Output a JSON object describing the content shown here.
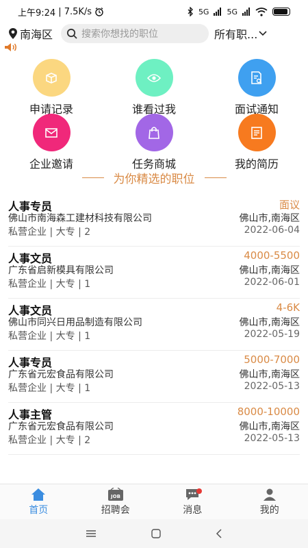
{
  "status_bar": {
    "time": "上午9:24",
    "speed": "| 7.5K/s",
    "signal1": "5G",
    "signal2": "5G"
  },
  "top_bar": {
    "location": "南海区",
    "search_placeholder": "搜索你想找的职位",
    "job_filter": "所有职..."
  },
  "quick_actions": [
    {
      "label": "申请记录",
      "icon": "box-icon",
      "color": "#fbd780"
    },
    {
      "label": "谁看过我",
      "icon": "eye-icon",
      "color": "#6ef0c2"
    },
    {
      "label": "面试通知",
      "icon": "document-search-icon",
      "color": "#3fa0f0"
    },
    {
      "label": "企业邀请",
      "icon": "envelope-icon",
      "color": "#f0287a"
    },
    {
      "label": "任务商城",
      "icon": "shopping-bag-icon",
      "color": "#a267e6"
    },
    {
      "label": "我的简历",
      "icon": "resume-icon",
      "color": "#f77a1f"
    }
  ],
  "section_title": "为你精选的职位",
  "jobs": [
    {
      "title": "人事专员",
      "salary": "面议",
      "company": "佛山市南海森工建材科技有限公司",
      "location": "佛山市,南海区",
      "meta": "私营企业 | 大专 | 2",
      "date": "2022-06-04"
    },
    {
      "title": "人事文员",
      "salary": "4000-5500",
      "company": "广东省启新模具有限公司",
      "location": "佛山市,南海区",
      "meta": "私营企业 | 大专 | 1",
      "date": "2022-06-01"
    },
    {
      "title": "人事文员",
      "salary": "4-6K",
      "company": "佛山市同兴日用品制造有限公司",
      "location": "佛山市,南海区",
      "meta": "私营企业 | 大专 | 1",
      "date": "2022-05-19"
    },
    {
      "title": "人事专员",
      "salary": "5000-7000",
      "company": "广东省元宏食品有限公司",
      "location": "佛山市,南海区",
      "meta": "私营企业 | 大专 | 1",
      "date": "2022-05-13"
    },
    {
      "title": "人事主管",
      "salary": "8000-10000",
      "company": "广东省元宏食品有限公司",
      "location": "佛山市,南海区",
      "meta": "私营企业 | 大专 | 2",
      "date": "2022-05-13"
    }
  ],
  "bottom_nav": [
    {
      "label": "首页",
      "icon": "home-icon",
      "active": true
    },
    {
      "label": "招聘会",
      "icon": "job-fair-icon",
      "active": false
    },
    {
      "label": "消息",
      "icon": "message-icon",
      "active": false
    },
    {
      "label": "我的",
      "icon": "user-icon",
      "active": false
    }
  ],
  "colors": {
    "accent": "#d98a45",
    "active_nav": "#3b8de0"
  }
}
